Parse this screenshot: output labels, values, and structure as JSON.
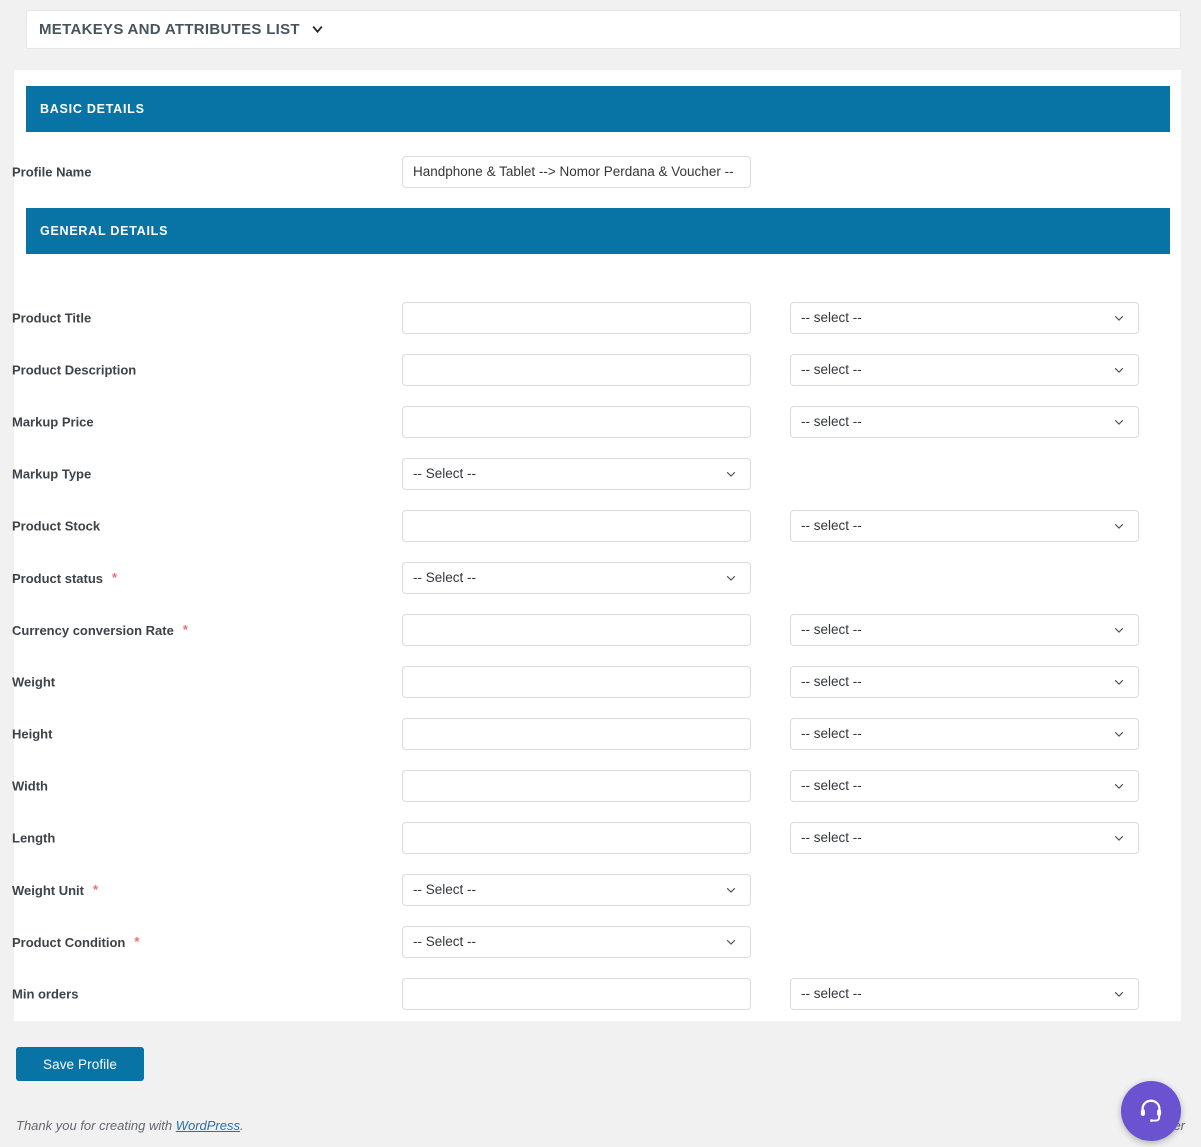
{
  "postbox": {
    "title": "METAKEYS AND ATTRIBUTES LIST",
    "toggle_icon": "chevron-down-icon"
  },
  "sections": {
    "basic": {
      "title": "BASIC DETAILS",
      "rows": [
        {
          "label": "Profile Name",
          "required": false,
          "mid": {
            "type": "text",
            "value": "Handphone & Tablet --> Nomor Perdana & Voucher --"
          },
          "right": null
        }
      ]
    },
    "general": {
      "title": "GENERAL DETAILS",
      "rows": [
        {
          "label": "Product Title",
          "required": false,
          "mid": {
            "type": "text",
            "value": ""
          },
          "right": {
            "type": "select",
            "value": "-- select --"
          }
        },
        {
          "label": "Product Description",
          "required": false,
          "mid": {
            "type": "text",
            "value": ""
          },
          "right": {
            "type": "select",
            "value": "-- select --"
          }
        },
        {
          "label": "Markup Price",
          "required": false,
          "mid": {
            "type": "text",
            "value": ""
          },
          "right": {
            "type": "select",
            "value": "-- select --"
          }
        },
        {
          "label": "Markup Type",
          "required": false,
          "mid": {
            "type": "select",
            "value": "-- Select --"
          },
          "right": null
        },
        {
          "label": "Product Stock",
          "required": false,
          "mid": {
            "type": "text",
            "value": ""
          },
          "right": {
            "type": "select",
            "value": "-- select --"
          }
        },
        {
          "label": "Product status",
          "required": true,
          "mid": {
            "type": "select",
            "value": "-- Select --"
          },
          "right": null
        },
        {
          "label": "Currency conversion Rate",
          "required": true,
          "mid": {
            "type": "text",
            "value": ""
          },
          "right": {
            "type": "select",
            "value": "-- select --"
          }
        },
        {
          "label": "Weight",
          "required": false,
          "mid": {
            "type": "text",
            "value": ""
          },
          "right": {
            "type": "select",
            "value": "-- select --"
          }
        },
        {
          "label": "Height",
          "required": false,
          "mid": {
            "type": "text",
            "value": ""
          },
          "right": {
            "type": "select",
            "value": "-- select --"
          }
        },
        {
          "label": "Width",
          "required": false,
          "mid": {
            "type": "text",
            "value": ""
          },
          "right": {
            "type": "select",
            "value": "-- select --"
          }
        },
        {
          "label": "Length",
          "required": false,
          "mid": {
            "type": "text",
            "value": ""
          },
          "right": {
            "type": "select",
            "value": "-- select --"
          }
        },
        {
          "label": "Weight Unit",
          "required": true,
          "mid": {
            "type": "select",
            "value": "-- Select --"
          },
          "right": null
        },
        {
          "label": "Product Condition",
          "required": true,
          "mid": {
            "type": "select",
            "value": "-- Select --"
          },
          "right": null
        },
        {
          "label": "Min orders",
          "required": false,
          "mid": {
            "type": "text",
            "value": ""
          },
          "right": {
            "type": "select",
            "value": "-- select --"
          }
        }
      ]
    }
  },
  "actions": {
    "save_label": "Save Profile"
  },
  "footer": {
    "thanks_prefix": "Thank you for creating with ",
    "wordpress_link": "WordPress",
    "thanks_suffix": ".",
    "version_text": "Ver"
  },
  "support": {
    "icon": "headset-icon"
  },
  "colors": {
    "section_bar": "#0873a5",
    "primary_button": "#0873a5",
    "required_asterisk": "#f26c6c",
    "page_background": "#f1f1f1",
    "support_fab": "#6a52d1",
    "link": "#2271b1"
  },
  "geometry": {
    "basic_row_tops": [
      156
    ],
    "general_row_tops": [
      302,
      354,
      406,
      458,
      510,
      562,
      614,
      666,
      718,
      770,
      822,
      874,
      926,
      978
    ]
  }
}
